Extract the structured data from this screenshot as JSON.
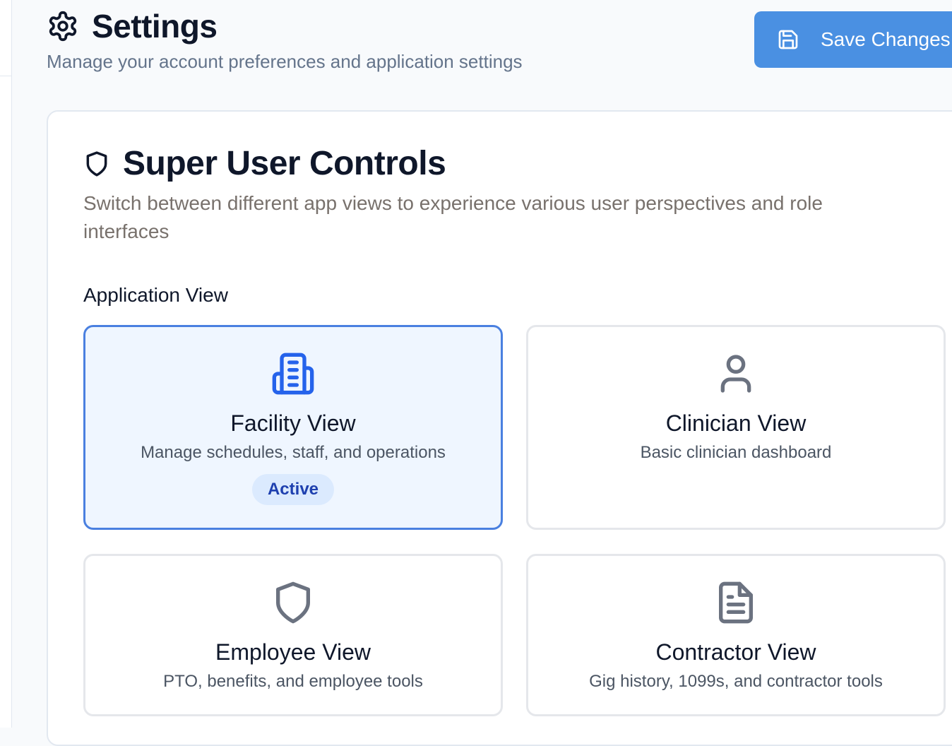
{
  "header": {
    "title": "Settings",
    "subtitle": "Manage your account preferences and application settings",
    "title_icon": "gear-icon"
  },
  "toolbar": {
    "save_label": "Save Changes",
    "save_icon": "save-icon"
  },
  "colors": {
    "accent": "#4a90e2",
    "active_border": "#4a80e0",
    "active_bg": "#eff6ff",
    "badge_bg": "#dbeafe",
    "badge_text": "#1e40af",
    "active_icon": "#2563eb",
    "inactive_icon": "#6b7280"
  },
  "super_user": {
    "title": "Super User Controls",
    "title_icon": "shield-icon",
    "description": "Switch between different app views to experience various user perspectives and role interfaces",
    "section_label": "Application View",
    "views": [
      {
        "id": "facility",
        "title": "Facility View",
        "description": "Manage schedules, staff, and operations",
        "icon": "building-icon",
        "active": true,
        "badge": "Active"
      },
      {
        "id": "clinician",
        "title": "Clinician View",
        "description": "Basic clinician dashboard",
        "icon": "user-icon",
        "active": false
      },
      {
        "id": "employee",
        "title": "Employee View",
        "description": "PTO, benefits, and employee tools",
        "icon": "shield-icon",
        "active": false
      },
      {
        "id": "contractor",
        "title": "Contractor View",
        "description": "Gig history, 1099s, and contractor tools",
        "icon": "document-icon",
        "active": false
      }
    ]
  }
}
